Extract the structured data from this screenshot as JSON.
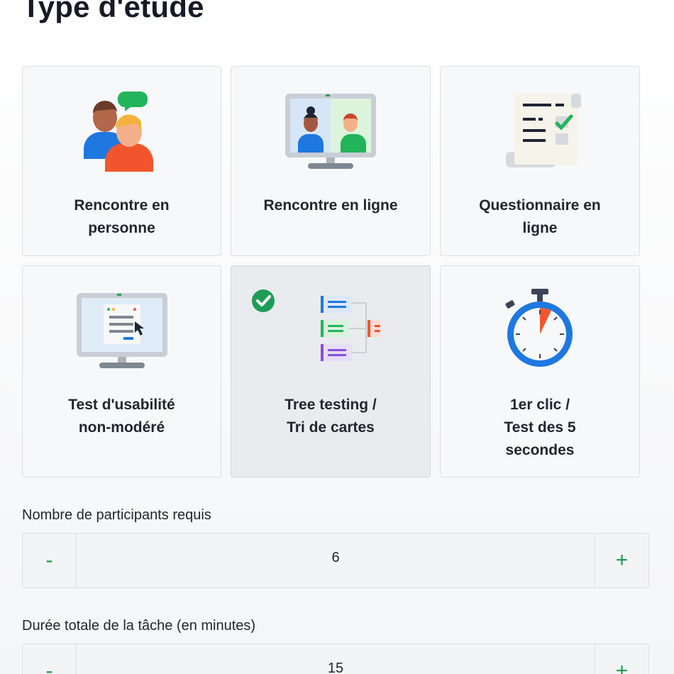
{
  "page_title": "Type d'étude",
  "study_types": [
    {
      "label": "Rencontre en\npersonne",
      "icon": "people-chat-icon",
      "selected": false
    },
    {
      "label": "Rencontre en ligne",
      "icon": "video-call-icon",
      "selected": false
    },
    {
      "label": "Questionnaire en\nligne",
      "icon": "questionnaire-icon",
      "selected": false
    },
    {
      "label": "Test d'usabilité\nnon-modéré",
      "icon": "monitor-cursor-icon",
      "selected": false
    },
    {
      "label": "Tree testing /\nTri de cartes",
      "icon": "tree-diagram-icon",
      "selected": true
    },
    {
      "label": "1er clic /\nTest des 5\nsecondes",
      "icon": "stopwatch-icon",
      "selected": false
    }
  ],
  "participants": {
    "label": "Nombre de participants requis",
    "value": "6",
    "minus": "-",
    "plus": "+"
  },
  "duration": {
    "label": "Durée totale de la tâche (en minutes)",
    "value": "15",
    "minus": "-",
    "plus": "+"
  },
  "colors": {
    "accent_green": "#1f9a52",
    "check_green": "#1e9d57"
  }
}
